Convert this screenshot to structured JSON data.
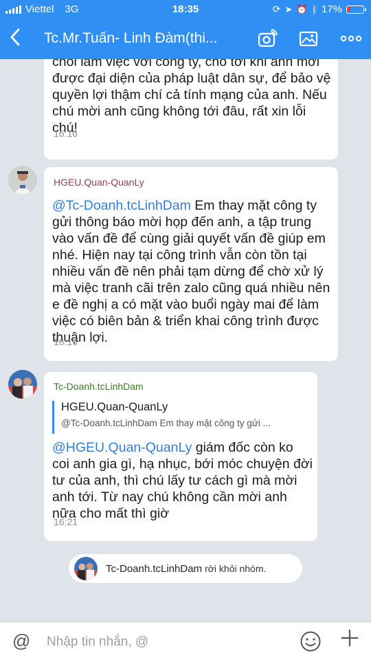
{
  "status_bar": {
    "carrier": "Viettel",
    "network": "3G",
    "time": "18:35",
    "battery": "17%"
  },
  "header": {
    "back_icon": "chevron-left-icon",
    "title": "Tc.Mr.Tuấn- Linh Đàm(thi..."
  },
  "messages": [
    {
      "text": "chối làm việc với công ty, cho tới khi anh mời được đại diện của pháp luật dân sự, để bảo vệ quyền lợi thậm chí cả tính mạng của anh. Nếu chú mời anh cũng không tới đâu, rất xin lỗi chú!",
      "time": "16:16"
    },
    {
      "sender": "HGEU.Quan-QuanLy",
      "mention": "@Tc-Doanh.tcLinhDam",
      "text": " Em thay mặt công ty gửi thông báo mời họp đến anh, a tập trung vào vấn đề để cùng giải quyết vấn đề giúp em nhé. Hiện nay tại công trình vẫn còn tồn tại nhiều vấn đề nên phải tạm dừng để chờ xử lý mà việc tranh cãi trên zalo cũng quá nhiều nên e đề nghị a có mặt vào buổi ngày mai để làm việc có biên bản & triển khai công trình được thuận lợi.",
      "time": "16:16"
    },
    {
      "sender": "Tc-Doanh.tcLinhDam",
      "quote_name": "HGEU.Quan-QuanLy",
      "quote_text": "@Tc-Doanh.tcLinhDam  Em thay mặt công ty gửi ...",
      "mention": "@HGEU.Quan-QuanLy",
      "text": " giám đốc còn ko coi anh gia gì, hạ nhục, bới móc chuyện đời tư của anh, thì chú lấy tư cách gì mà mời anh tới. Từ nay chú không cần mời anh nữa cho mất thì giờ",
      "time": "16:21"
    }
  ],
  "system_message": {
    "name": "Tc-Doanh.tcLinhDam",
    "text": "rời khỏi nhóm."
  },
  "input": {
    "placeholder": "Nhập tin nhắn, @"
  },
  "colors": {
    "header_bg": "#2f8ff3",
    "mention": "#2f7fe2",
    "chat_bg": "#dfe4ea"
  }
}
